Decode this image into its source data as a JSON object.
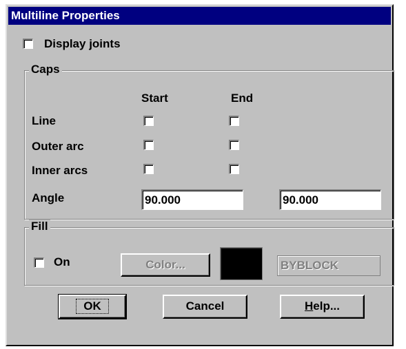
{
  "window": {
    "title": "Multiline Properties"
  },
  "display_joints": {
    "label": "Display joints",
    "checked": false
  },
  "caps": {
    "title": "Caps",
    "start_header": "Start",
    "end_header": "End",
    "rows": [
      {
        "label": "Line",
        "start": false,
        "end": false
      },
      {
        "label": "Outer arc",
        "start": false,
        "end": false
      },
      {
        "label": "Inner arcs",
        "start": false,
        "end": false
      }
    ],
    "angle_label": "Angle",
    "angle_start": "90.000",
    "angle_end": "90.000"
  },
  "fill": {
    "title": "Fill",
    "on_label": "On",
    "on_checked": false,
    "color_button": "Color...",
    "color_swatch": "#000000",
    "color_name": "BYBLOCK"
  },
  "buttons": {
    "ok": "OK",
    "cancel": "Cancel",
    "help_hotkey": "H",
    "help_rest": "elp..."
  }
}
